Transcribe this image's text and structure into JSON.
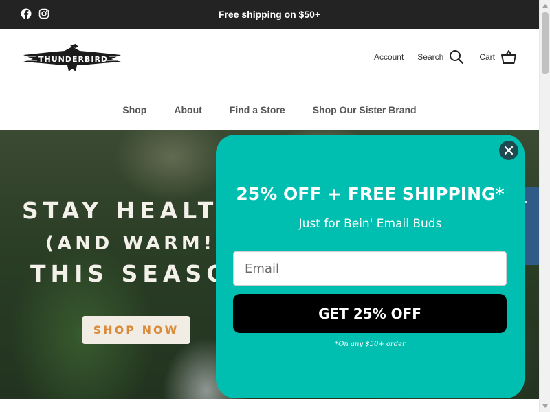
{
  "announcement": {
    "text": "Free shipping on $50+",
    "social_icons": [
      "facebook-icon",
      "instagram-icon"
    ]
  },
  "header": {
    "logo_text": "THUNDERBIRD",
    "account_label": "Account",
    "search_label": "Search",
    "cart_label": "Cart"
  },
  "nav": {
    "items": [
      {
        "label": "Shop"
      },
      {
        "label": "About"
      },
      {
        "label": "Find a Store"
      },
      {
        "label": "Shop Our Sister Brand"
      }
    ]
  },
  "hero": {
    "line1": "STAY HEALT",
    "line2": "(AND WARM!",
    "line3": "THIS SEASO",
    "cta_label": "SHOP NOW"
  },
  "popup": {
    "title": "25% OFF + FREE SHIPPING*",
    "subtitle": "Just for Bein' Email Buds",
    "email_placeholder": "Email",
    "button_label": "GET 25% OFF",
    "fine_print": "*On any $50+ order"
  },
  "colors": {
    "announcement_bg": "#232323",
    "popup_bg": "#00bfb0",
    "close_button_bg": "#1e4a50",
    "cta_text": "#d98b3a",
    "side_tab": "#2f5b86"
  }
}
